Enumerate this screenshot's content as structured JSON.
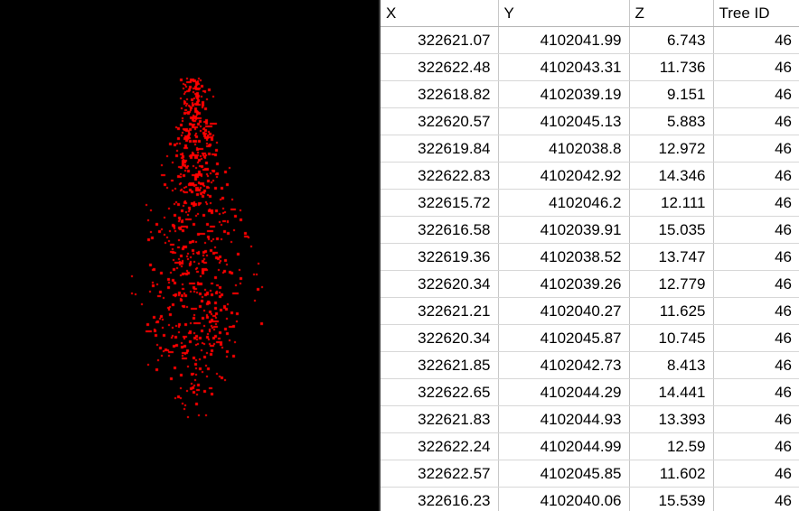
{
  "viewer": {
    "name": "point-cloud-viewer",
    "background_color": "#000000",
    "point_color": "#ff0000",
    "description": "3D LiDAR point cloud of a single tree rendered as red points on a black background",
    "point_count": 900,
    "cloud_bounds": {
      "x_min": 150,
      "x_max": 282,
      "y_min": 84,
      "y_max": 462
    }
  },
  "table": {
    "name": "attribute-table",
    "columns": [
      {
        "key": "x",
        "label": "X"
      },
      {
        "key": "y",
        "label": "Y"
      },
      {
        "key": "z",
        "label": "Z"
      },
      {
        "key": "tree_id",
        "label": "Tree ID"
      }
    ],
    "rows": [
      {
        "x": "322621.07",
        "y": "4102041.99",
        "z": "6.743",
        "tree_id": "46"
      },
      {
        "x": "322622.48",
        "y": "4102043.31",
        "z": "11.736",
        "tree_id": "46"
      },
      {
        "x": "322618.82",
        "y": "4102039.19",
        "z": "9.151",
        "tree_id": "46"
      },
      {
        "x": "322620.57",
        "y": "4102045.13",
        "z": "5.883",
        "tree_id": "46"
      },
      {
        "x": "322619.84",
        "y": "4102038.8",
        "z": "12.972",
        "tree_id": "46"
      },
      {
        "x": "322622.83",
        "y": "4102042.92",
        "z": "14.346",
        "tree_id": "46"
      },
      {
        "x": "322615.72",
        "y": "4102046.2",
        "z": "12.111",
        "tree_id": "46"
      },
      {
        "x": "322616.58",
        "y": "4102039.91",
        "z": "15.035",
        "tree_id": "46"
      },
      {
        "x": "322619.36",
        "y": "4102038.52",
        "z": "13.747",
        "tree_id": "46"
      },
      {
        "x": "322620.34",
        "y": "4102039.26",
        "z": "12.779",
        "tree_id": "46"
      },
      {
        "x": "322621.21",
        "y": "4102040.27",
        "z": "11.625",
        "tree_id": "46"
      },
      {
        "x": "322620.34",
        "y": "4102045.87",
        "z": "10.745",
        "tree_id": "46"
      },
      {
        "x": "322621.85",
        "y": "4102042.73",
        "z": "8.413",
        "tree_id": "46"
      },
      {
        "x": "322622.65",
        "y": "4102044.29",
        "z": "14.441",
        "tree_id": "46"
      },
      {
        "x": "322621.83",
        "y": "4102044.93",
        "z": "13.393",
        "tree_id": "46"
      },
      {
        "x": "322622.24",
        "y": "4102044.99",
        "z": "12.59",
        "tree_id": "46"
      },
      {
        "x": "322622.57",
        "y": "4102045.85",
        "z": "11.602",
        "tree_id": "46"
      },
      {
        "x": "322616.23",
        "y": "4102040.06",
        "z": "15.539",
        "tree_id": "46"
      }
    ]
  }
}
